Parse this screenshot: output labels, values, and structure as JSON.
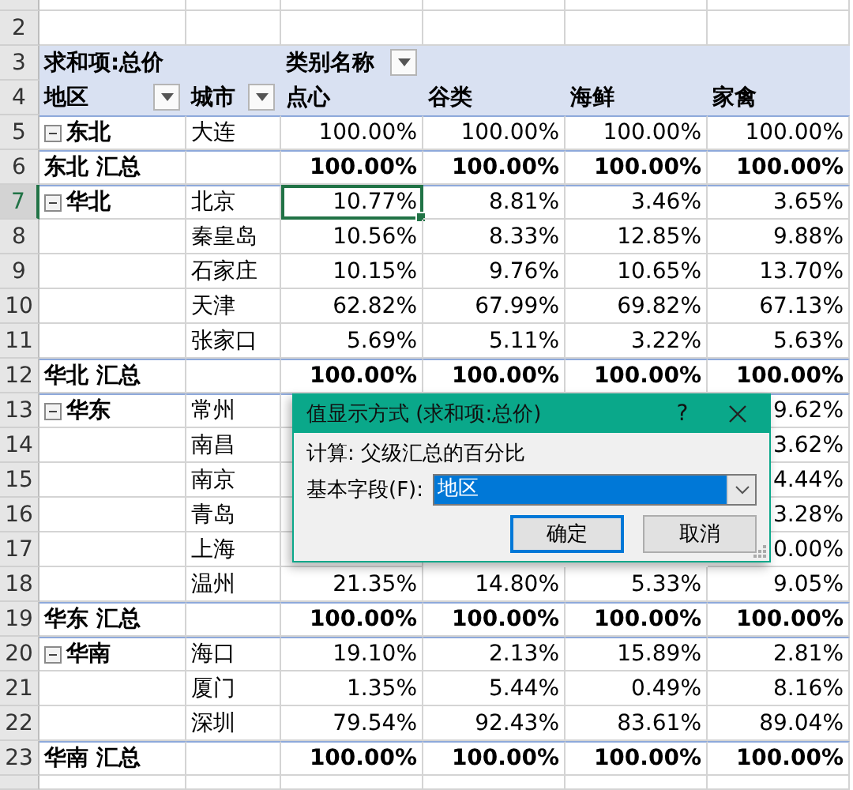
{
  "header": {
    "value_field": "求和项:总价",
    "column_field": "类别名称",
    "row_fields": [
      "地区",
      "城市"
    ],
    "categories": [
      "点心",
      "谷类",
      "海鲜",
      "家禽"
    ]
  },
  "rows": [
    {
      "number": "5",
      "kind": "region",
      "region": "东北",
      "expanded": true,
      "city": "大连",
      "values": [
        "100.00%",
        "100.00%",
        "100.00%",
        "100.00%"
      ],
      "selected": false
    },
    {
      "number": "6",
      "kind": "total",
      "region": "东北 汇总",
      "values": [
        "100.00%",
        "100.00%",
        "100.00%",
        "100.00%"
      ],
      "selected": false
    },
    {
      "number": "7",
      "kind": "region",
      "region": "华北",
      "expanded": true,
      "city": "北京",
      "values": [
        "10.77%",
        "8.81%",
        "3.46%",
        "3.65%"
      ],
      "selected": true
    },
    {
      "number": "8",
      "kind": "city",
      "city": "秦皇岛",
      "values": [
        "10.56%",
        "8.33%",
        "12.85%",
        "9.88%"
      ],
      "selected": false
    },
    {
      "number": "9",
      "kind": "city",
      "city": "石家庄",
      "values": [
        "10.15%",
        "9.76%",
        "10.65%",
        "13.70%"
      ],
      "selected": false
    },
    {
      "number": "10",
      "kind": "city",
      "city": "天津",
      "values": [
        "62.82%",
        "67.99%",
        "69.82%",
        "67.13%"
      ],
      "selected": false
    },
    {
      "number": "11",
      "kind": "city",
      "city": "张家口",
      "values": [
        "5.69%",
        "5.11%",
        "3.22%",
        "5.63%"
      ],
      "selected": false
    },
    {
      "number": "12",
      "kind": "total",
      "region": "华北 汇总",
      "values": [
        "100.00%",
        "100.00%",
        "100.00%",
        "100.00%"
      ],
      "selected": false
    },
    {
      "number": "13",
      "kind": "region",
      "region": "华东",
      "expanded": true,
      "city": "常州",
      "last_value": "9.62%",
      "selected": false
    },
    {
      "number": "14",
      "kind": "city",
      "city": "南昌",
      "last_value": "3.62%",
      "selected": false
    },
    {
      "number": "15",
      "kind": "city",
      "city": "南京",
      "last_value": "4.44%",
      "selected": false
    },
    {
      "number": "16",
      "kind": "city",
      "city": "青岛",
      "last_value": "3.28%",
      "selected": false
    },
    {
      "number": "17",
      "kind": "city",
      "city": "上海",
      "last_value": "0.00%",
      "selected": false
    },
    {
      "number": "18",
      "kind": "city",
      "city": "温州",
      "values": [
        "21.35%",
        "14.80%",
        "5.33%",
        "9.05%"
      ],
      "selected": false
    },
    {
      "number": "19",
      "kind": "total",
      "region": "华东 汇总",
      "values": [
        "100.00%",
        "100.00%",
        "100.00%",
        "100.00%"
      ],
      "selected": false
    },
    {
      "number": "20",
      "kind": "region",
      "region": "华南",
      "expanded": true,
      "city": "海口",
      "values": [
        "19.10%",
        "2.13%",
        "15.89%",
        "2.81%"
      ],
      "selected": false
    },
    {
      "number": "21",
      "kind": "city",
      "city": "厦门",
      "values": [
        "1.35%",
        "5.44%",
        "0.49%",
        "8.16%"
      ],
      "selected": false
    },
    {
      "number": "22",
      "kind": "city",
      "city": "深圳",
      "values": [
        "79.54%",
        "92.43%",
        "83.61%",
        "89.04%"
      ],
      "selected": false
    },
    {
      "number": "23",
      "kind": "total",
      "region": "华南 汇总",
      "values": [
        "100.00%",
        "100.00%",
        "100.00%",
        "100.00%"
      ],
      "selected": false
    }
  ],
  "blank_rows": [
    "2"
  ],
  "header_row_numbers": [
    "3",
    "4"
  ],
  "dialog": {
    "title": "值显示方式 (求和项:总价)",
    "help": "?",
    "calculation": "计算: 父级汇总的百分比",
    "field_label": "基本字段(F):",
    "field_value": "地区",
    "buttons": [
      {
        "label": "确定",
        "default": true
      },
      {
        "label": "取消",
        "default": false
      }
    ]
  }
}
